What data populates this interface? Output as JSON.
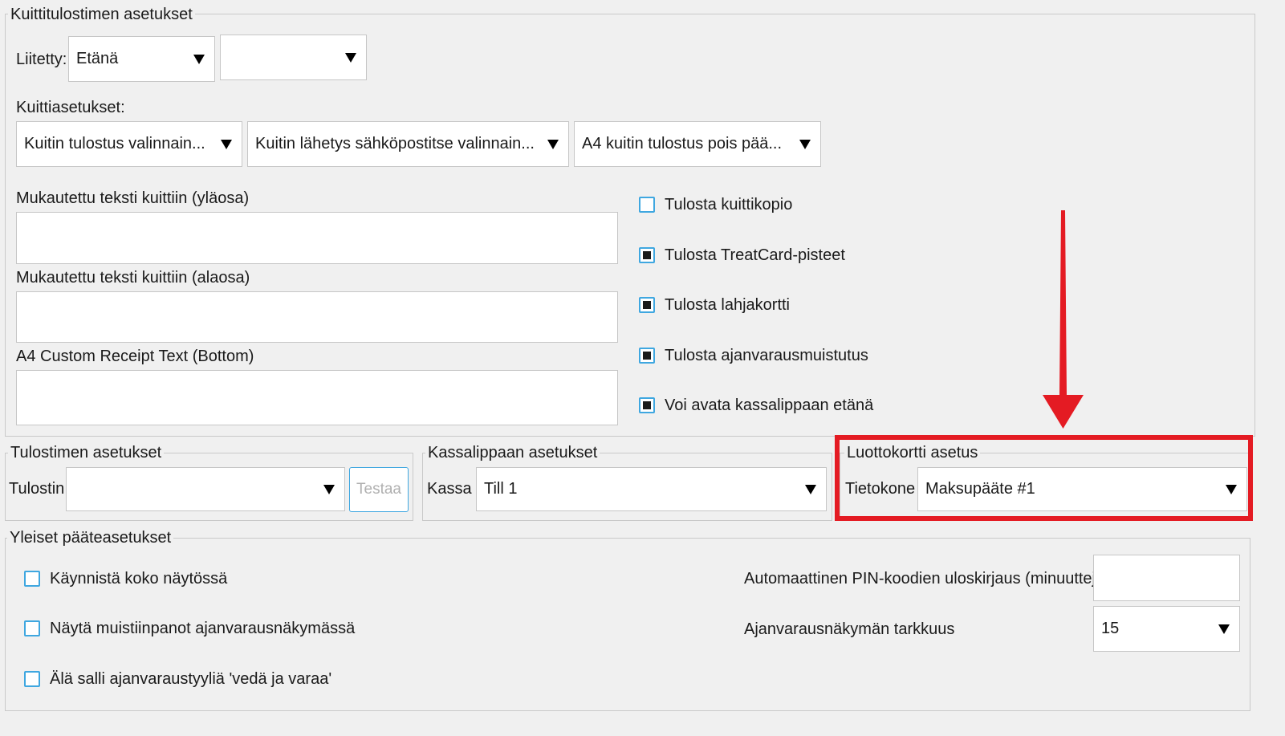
{
  "receipt_printer": {
    "legend": "Kuittitulostimen asetukset",
    "connected_label": "Liitetty:",
    "connected_value": "Etänä",
    "second_select_value": "",
    "receipt_settings_label": "Kuittiasetukset:",
    "receipt_print_value": "Kuitin tulostus valinnain...",
    "receipt_email_value": "Kuitin lähetys sähköpostitse valinnain...",
    "a4_print_value": "A4 kuitin tulostus pois pää...",
    "custom_top_label": "Mukautettu teksti kuittiin (yläosa)",
    "custom_top_value": "",
    "custom_bottom_label": "Mukautettu teksti kuittiin (alaosa)",
    "custom_bottom_value": "",
    "a4_custom_label": "A4 Custom Receipt Text (Bottom)",
    "a4_custom_value": "",
    "checkboxes": [
      {
        "label": "Tulosta kuittikopio",
        "checked": false
      },
      {
        "label": "Tulosta TreatCard-pisteet",
        "checked": true
      },
      {
        "label": "Tulosta lahjakortti",
        "checked": true
      },
      {
        "label": "Tulosta ajanvarausmuistutus",
        "checked": true
      },
      {
        "label": "Voi avata kassalippaan etänä",
        "checked": true
      }
    ]
  },
  "printer_settings": {
    "legend": "Tulostimen asetukset",
    "printer_label": "Tulostin",
    "printer_value": "",
    "test_button": "Testaa"
  },
  "drawer_settings": {
    "legend": "Kassalippaan asetukset",
    "till_label": "Kassa",
    "till_value": "Till 1"
  },
  "credit_card": {
    "legend": "Luottokortti asetus",
    "terminal_label": "Tietokone",
    "terminal_value": "Maksupääte #1"
  },
  "general": {
    "legend": "Yleiset pääteasetukset",
    "checkboxes": [
      {
        "label": "Käynnistä koko näytössä",
        "checked": false
      },
      {
        "label": "Näytä muistiinpanot ajanvarausnäkymässä",
        "checked": false
      },
      {
        "label": "Älä salli ajanvaraustyyliä 'vedä ja varaa'",
        "checked": false
      }
    ],
    "pin_logout_label": "Automaattinen PIN-koodien uloskirjaus (minuutteja)",
    "pin_logout_value": "",
    "calendar_precision_label": "Ajanvarausnäkymän tarkkuus",
    "calendar_precision_value": "15"
  },
  "annotation_colors": {
    "highlight": "#e41b23",
    "checkbox_border": "#3fa7e0"
  }
}
